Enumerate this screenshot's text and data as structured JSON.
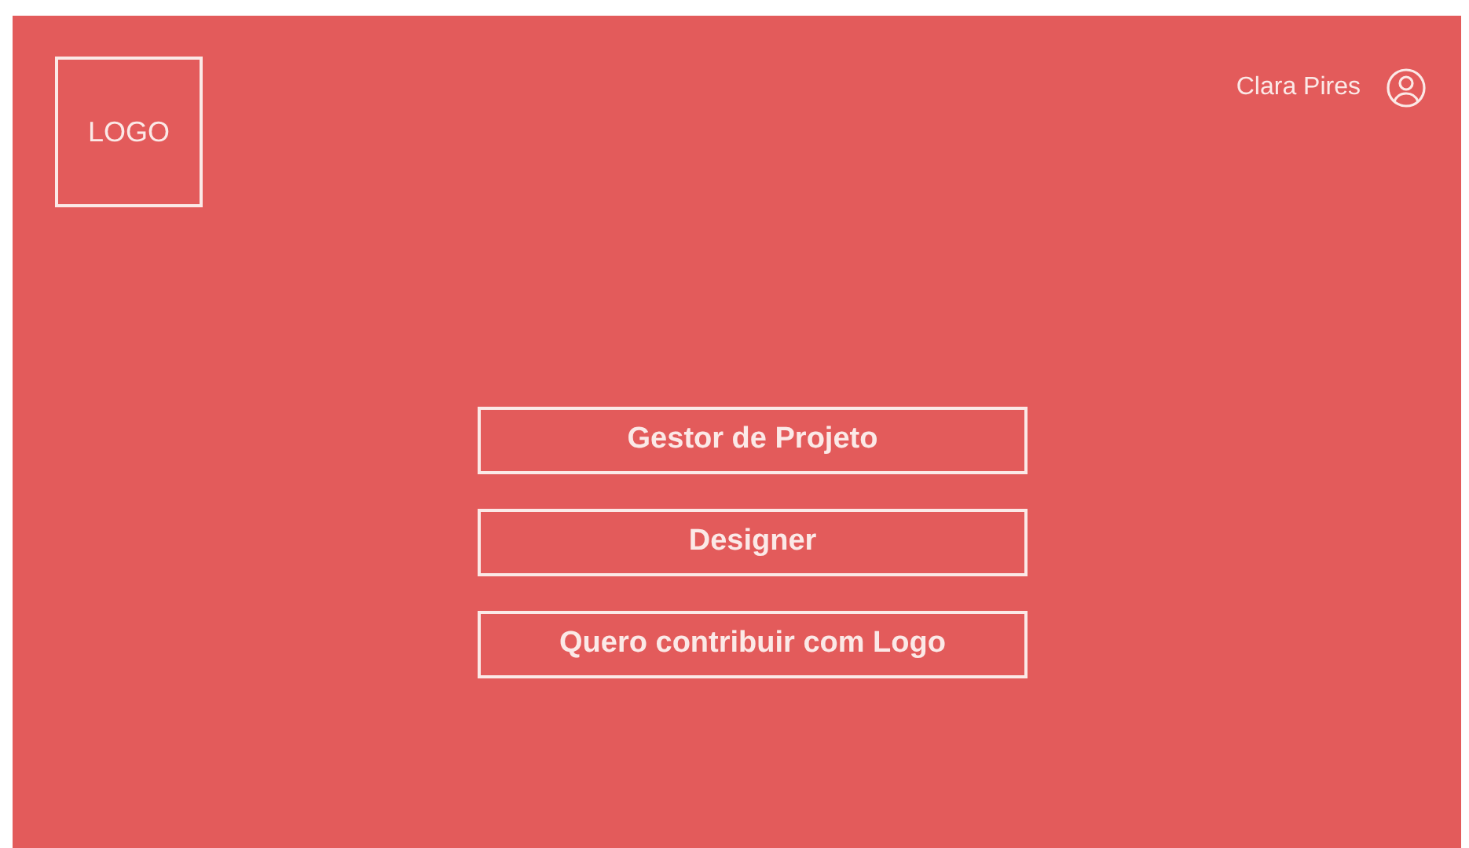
{
  "header": {
    "logo": "LOGO",
    "user_name": "Clara Pires"
  },
  "options": [
    {
      "label": "Gestor de Projeto"
    },
    {
      "label": "Designer"
    },
    {
      "label": "Quero contribuir com Logo"
    }
  ]
}
